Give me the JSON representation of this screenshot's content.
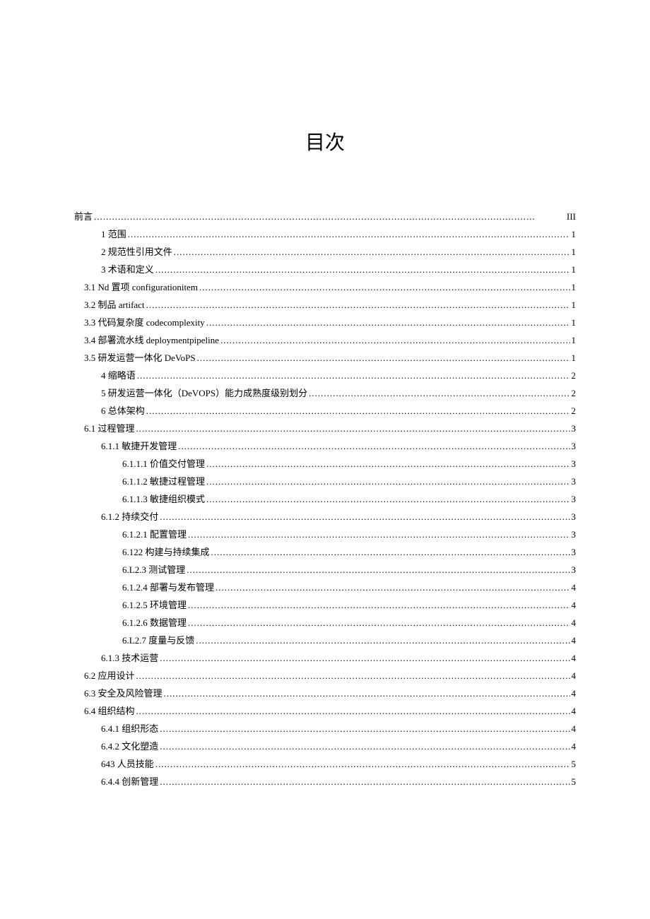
{
  "title": "目次",
  "toc": [
    {
      "indent": "level-0",
      "label": "前言",
      "page": "III"
    },
    {
      "indent": "level-1",
      "label": "1 范围",
      "page": "1"
    },
    {
      "indent": "level-1",
      "label": "2 规范性引用文件",
      "page": "1"
    },
    {
      "indent": "level-1",
      "label": "3 术语和定义",
      "page": "1"
    },
    {
      "indent": "level-1b",
      "label": "3.1  Nd 置项 configurationitem",
      "page": "1"
    },
    {
      "indent": "level-1b",
      "label": "3.2  制品 artifact",
      "page": "1"
    },
    {
      "indent": "level-1b",
      "label": "3.3  代码复杂度 codecomplexity",
      "page": "1"
    },
    {
      "indent": "level-1b",
      "label": "3.4  部署流水线 deploymentpipeline",
      "page": "1"
    },
    {
      "indent": "level-1b",
      "label": "3.5  研发运营一体化 DeVoPS",
      "page": "1"
    },
    {
      "indent": "level-1",
      "label": "4 缩略语",
      "page": "2"
    },
    {
      "indent": "level-1",
      "label": "5 研发运营一体化（DeVOPS）能力成熟度级别划分",
      "page": "2"
    },
    {
      "indent": "level-1",
      "label": "6 总体架构",
      "page": "2"
    },
    {
      "indent": "level-1b",
      "label": "6.1  过程管理",
      "page": "3"
    },
    {
      "indent": "level-2",
      "label": "6.1.1 敏捷开发管理",
      "page": "3"
    },
    {
      "indent": "level-3",
      "label": "6.1.1.1 价值交付管理",
      "page": "3"
    },
    {
      "indent": "level-3",
      "label": "6.1.1.2 敏捷过程管理",
      "page": "3"
    },
    {
      "indent": "level-3",
      "label": "6.1.1.3 敏捷组织模式",
      "page": "3"
    },
    {
      "indent": "level-2",
      "label": "6.1.2 持续交付",
      "page": "3"
    },
    {
      "indent": "level-3",
      "label": "6.1.2.1 配置管理",
      "page": "3"
    },
    {
      "indent": "level-3",
      "label": "6.122 构建与持续集成",
      "page": "3"
    },
    {
      "indent": "level-3",
      "label": "6.L2.3 测试管理",
      "page": "3"
    },
    {
      "indent": "level-3",
      "label": "6.1.2.4 部署与发布管理",
      "page": "4"
    },
    {
      "indent": "level-3",
      "label": "6.1.2.5 环境管理",
      "page": "4"
    },
    {
      "indent": "level-3",
      "label": "6.1.2.6 数据管理",
      "page": "4"
    },
    {
      "indent": "level-3",
      "label": "6.L2.7 度量与反馈",
      "page": "4"
    },
    {
      "indent": "level-2",
      "label": "6.1.3 技术运营",
      "page": "4"
    },
    {
      "indent": "level-1b",
      "label": "6.2  应用设计",
      "page": "4"
    },
    {
      "indent": "level-1b",
      "label": "6.3  安全及风险管理",
      "page": "4"
    },
    {
      "indent": "level-1b",
      "label": "6.4  组织结构",
      "page": "4"
    },
    {
      "indent": "level-2",
      "label": "6.4.1 组织形态",
      "page": "4"
    },
    {
      "indent": "level-2",
      "label": "6.4.2 文化塑造",
      "page": "4"
    },
    {
      "indent": "level-2",
      "label": "643 人员技能",
      "page": "5"
    },
    {
      "indent": "level-2",
      "label": "6.4.4 创新管理",
      "page": "5"
    }
  ]
}
